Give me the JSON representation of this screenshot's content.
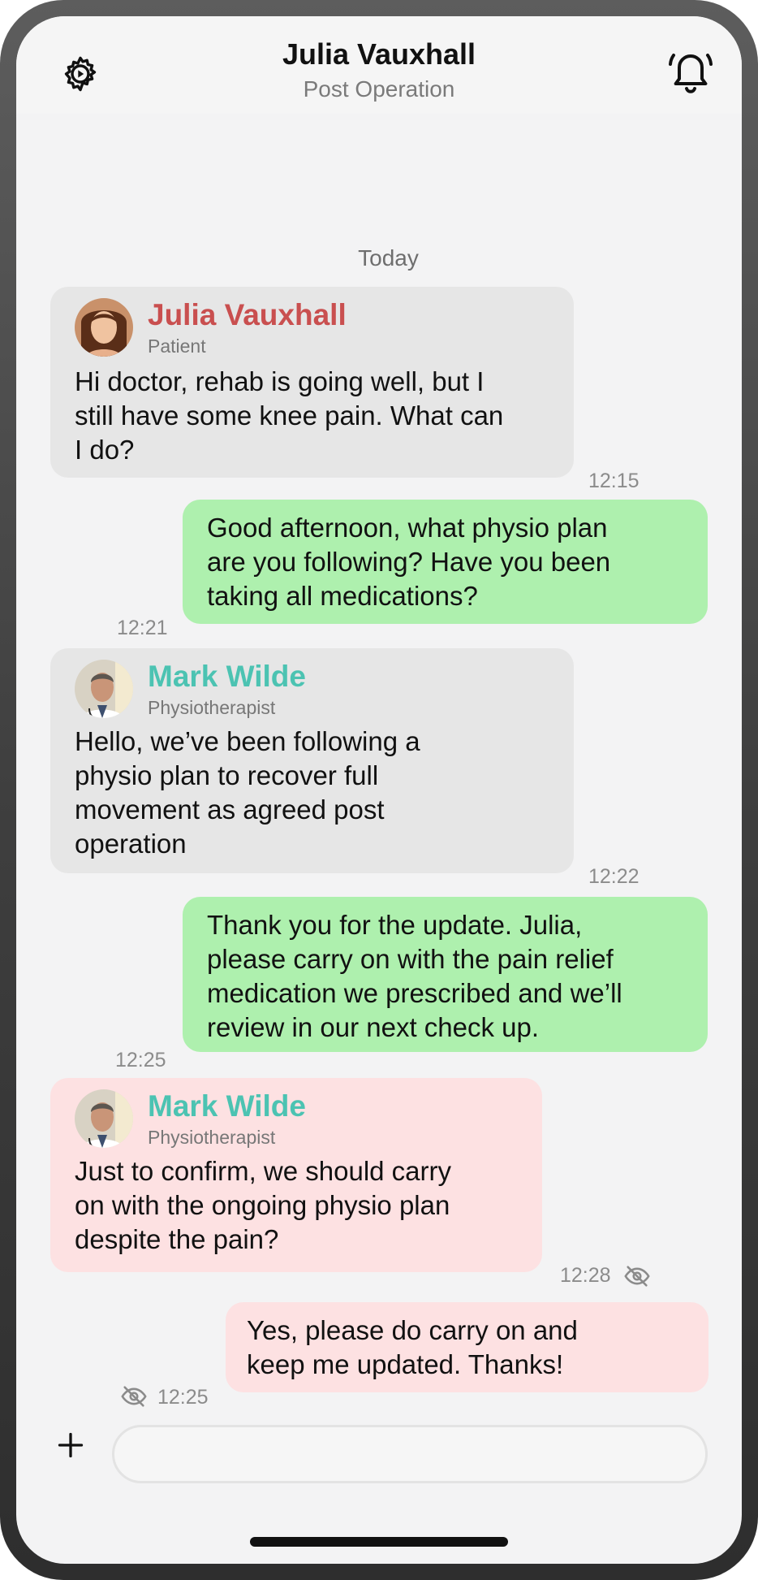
{
  "header": {
    "title": "Julia Vauxhall",
    "subtitle": "Post Operation",
    "settings_icon": "gear-icon",
    "notifications_icon": "bell-icon"
  },
  "day_separator": "Today",
  "messages": [
    {
      "sender": "Julia Vauxhall",
      "role": "Patient",
      "sender_color": "#c94f4f",
      "text_lines": [
        "Hi doctor, rehab is going well, but I",
        "still have some knee pain. What can",
        "I do?"
      ],
      "time": "12:15"
    },
    {
      "text_lines": [
        "Good afternoon, what physio plan",
        "are you following? Have you been",
        "taking all medications?"
      ],
      "time": "12:21"
    },
    {
      "sender": "Mark Wilde",
      "role": "Physiotherapist",
      "sender_color": "#4cc3b2",
      "text_lines": [
        "Hello, we’ve been following a",
        "physio plan to recover full",
        "movement as agreed post",
        "operation"
      ],
      "time": "12:22"
    },
    {
      "text_lines": [
        "Thank you for the update. Julia,",
        "please carry on with the pain relief",
        "medication we prescribed and we’ll",
        "review in our next check up."
      ],
      "time": "12:25"
    },
    {
      "sender": "Mark Wilde",
      "role": "Physiotherapist",
      "sender_color": "#4cc3b2",
      "text_lines": [
        "Just to confirm, we should carry",
        "on with the ongoing physio plan",
        "despite the pain?"
      ],
      "time": "12:28",
      "hidden_icon": "eye-off-icon"
    },
    {
      "text_lines": [
        "Yes, please do carry on and",
        "keep me updated. Thanks!"
      ],
      "time": "12:25",
      "hidden_icon": "eye-off-icon"
    }
  ],
  "composer": {
    "add_icon": "plus-icon",
    "placeholder": ""
  },
  "colors": {
    "incoming_bubble": "#e6e6e6",
    "outgoing_bubble": "#aef0ae",
    "flagged_bubble": "#fde1e2"
  }
}
